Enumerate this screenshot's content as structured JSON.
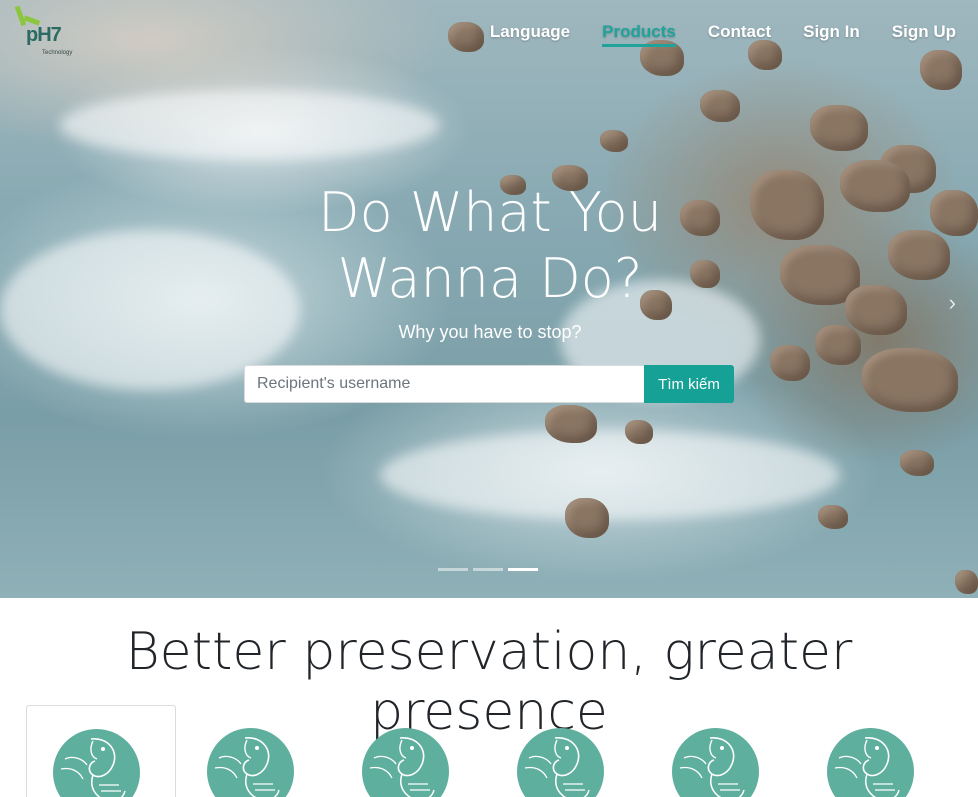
{
  "brand": {
    "name": "pH7",
    "tagline": "Technology"
  },
  "nav": {
    "items": [
      {
        "label": "Language",
        "active": false
      },
      {
        "label": "Products",
        "active": true
      },
      {
        "label": "Contact",
        "active": false
      },
      {
        "label": "Sign In",
        "active": false
      },
      {
        "label": "Sign Up",
        "active": false
      }
    ]
  },
  "hero": {
    "headline_line1": "Do What You",
    "headline_line2": "Wanna Do?",
    "subheadline": "Why you have to stop?",
    "search": {
      "placeholder": "Recipient's username",
      "button_label": "Tìm kiếm"
    },
    "carousel": {
      "slides": 3,
      "active_slide": 3
    }
  },
  "section": {
    "title": "Better preservation, greater presence",
    "cards": [
      {
        "icon": "shrimp-icon",
        "selected": true
      },
      {
        "icon": "shrimp-icon",
        "selected": false
      },
      {
        "icon": "shrimp-icon",
        "selected": false
      },
      {
        "icon": "shrimp-icon",
        "selected": false
      },
      {
        "icon": "shrimp-icon",
        "selected": false
      },
      {
        "icon": "shrimp-icon",
        "selected": false
      }
    ]
  },
  "colors": {
    "accent": "#16a196",
    "icon_circle": "#5eaf9e",
    "text": "#212529"
  }
}
